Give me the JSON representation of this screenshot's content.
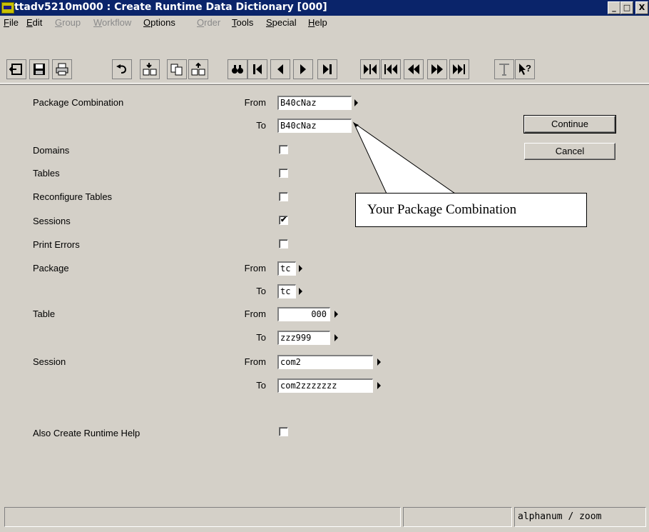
{
  "window": {
    "title": "ttadv5210m000 : Create Runtime Data Dictionary [000]",
    "controls": [
      "_",
      "□",
      "X"
    ]
  },
  "menu": [
    {
      "label": "File",
      "enabled": true
    },
    {
      "label": "Edit",
      "enabled": true
    },
    {
      "label": "Group",
      "enabled": false
    },
    {
      "label": "Workflow",
      "enabled": false
    },
    {
      "label": "Options",
      "enabled": true
    },
    {
      "label": "Order",
      "enabled": false
    },
    {
      "label": "Tools",
      "enabled": true
    },
    {
      "label": "Special",
      "enabled": true
    },
    {
      "label": "Help",
      "enabled": true
    }
  ],
  "toolbar_icons": [
    "exit-icon",
    "save-icon",
    "print-icon",
    "undo-icon",
    "insert-record-icon",
    "copy-icon",
    "duplicate-record-icon",
    "find-icon",
    "first-record-icon",
    "previous-record-icon",
    "next-record-icon",
    "last-record-icon",
    "first-group-icon",
    "previous-group-icon",
    "previous-set-icon",
    "next-set-icon",
    "last-set-icon",
    "text-icon",
    "help-pointer-icon"
  ],
  "form": {
    "from_label": "From",
    "to_label": "To",
    "package_combination": {
      "label": "Package Combination",
      "from": "B40cNaz",
      "to": "B40cNaz"
    },
    "domains": {
      "label": "Domains",
      "checked": false
    },
    "tables": {
      "label": "Tables",
      "checked": false
    },
    "reconfigure_tables": {
      "label": "Reconfigure Tables",
      "checked": false
    },
    "sessions": {
      "label": "Sessions",
      "checked": true
    },
    "print_errors": {
      "label": "Print Errors",
      "checked": false
    },
    "package": {
      "label": "Package",
      "from": "tc",
      "to": "tc"
    },
    "table": {
      "label": "Table",
      "from": "000",
      "to": "zzz999"
    },
    "session": {
      "label": "Session",
      "from": "com2",
      "to": "com2zzzzzzz"
    },
    "runtime_help": {
      "label": "Also Create Runtime Help",
      "checked": false
    }
  },
  "buttons": {
    "continue": "Continue",
    "cancel": "Cancel"
  },
  "callout": "Your Package Combination",
  "status": {
    "mode": "alphanum / zoom"
  }
}
